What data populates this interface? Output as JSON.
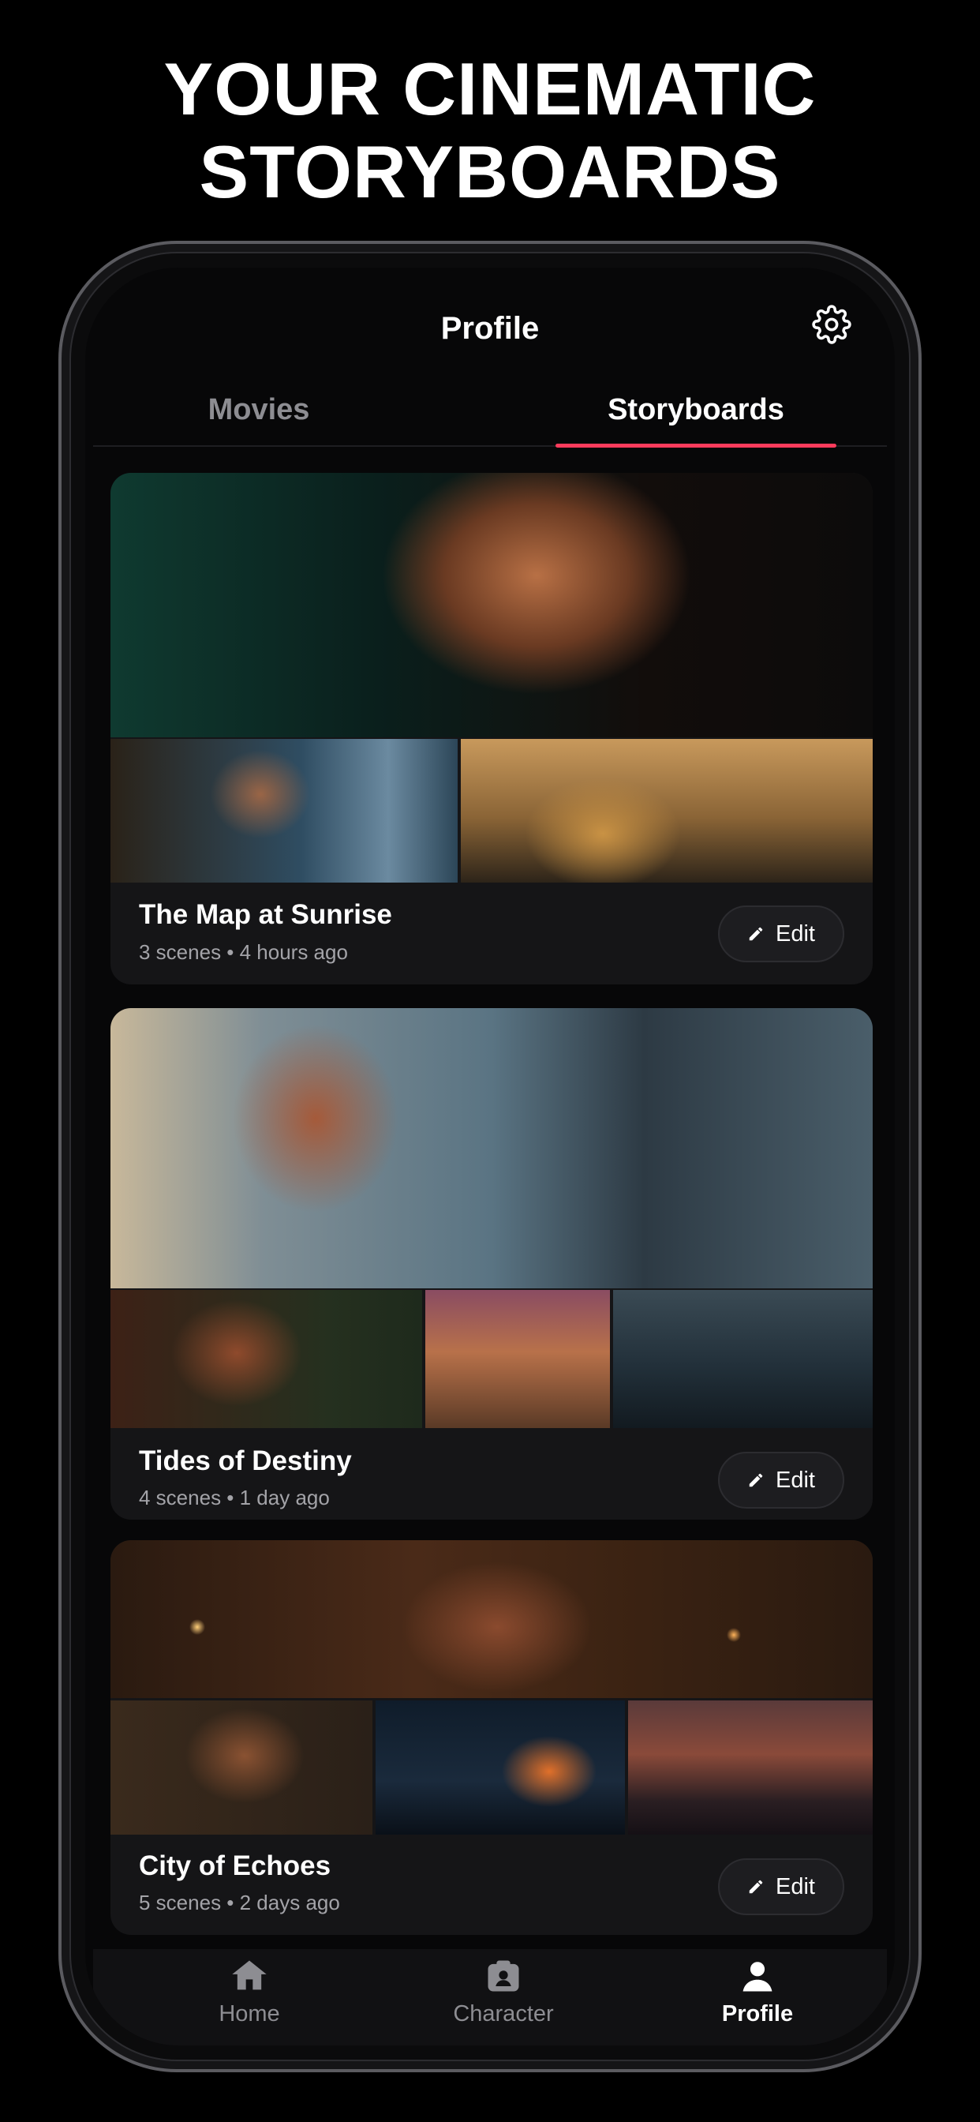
{
  "headline": {
    "line1": "YOUR CINEMATIC",
    "line2": "STORYBOARDS"
  },
  "header": {
    "title": "Profile",
    "settings_icon": "gear-icon"
  },
  "tabs": [
    {
      "label": "Movies",
      "active": false
    },
    {
      "label": "Storyboards",
      "active": true
    }
  ],
  "accent_color": "#ff3b5c",
  "storyboards": [
    {
      "title": "The Map at Sunrise",
      "meta": "3 scenes • 4 hours ago",
      "edit_label": "Edit"
    },
    {
      "title": "Tides of Destiny",
      "meta": "4 scenes • 1 day ago",
      "edit_label": "Edit"
    },
    {
      "title": "City of Echoes",
      "meta": "5 scenes • 2 days ago",
      "edit_label": "Edit"
    }
  ],
  "bottom_nav": [
    {
      "label": "Home",
      "icon": "home-icon",
      "active": false
    },
    {
      "label": "Character",
      "icon": "character-icon",
      "active": false
    },
    {
      "label": "Profile",
      "icon": "person-icon",
      "active": true
    }
  ]
}
